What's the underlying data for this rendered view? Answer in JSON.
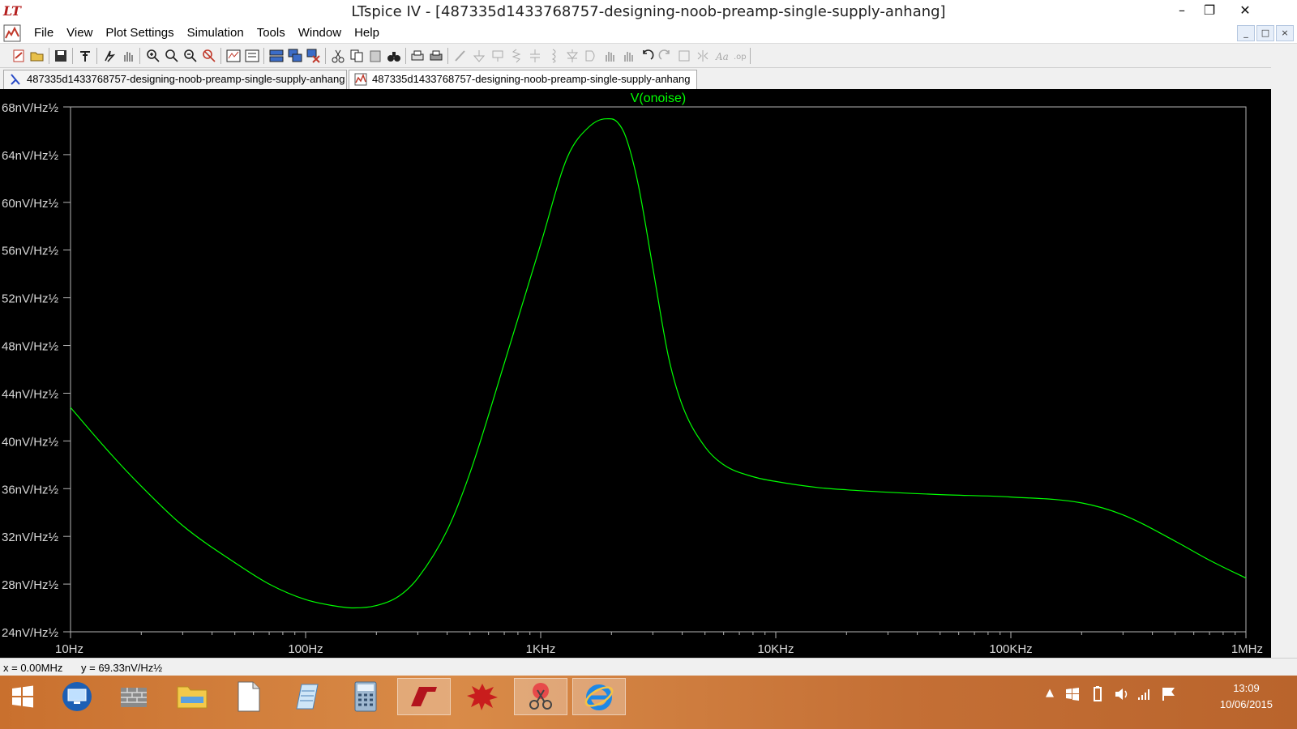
{
  "window": {
    "title": "LTspice IV - [487335d1433768757-designing-noob-preamp-single-supply-anhang]",
    "minimize": "–",
    "restore": "❐",
    "close": "✕"
  },
  "menu": {
    "items": [
      "File",
      "View",
      "Plot Settings",
      "Simulation",
      "Tools",
      "Window",
      "Help"
    ],
    "mdi": [
      "_",
      "□",
      "×"
    ]
  },
  "tabs": [
    {
      "label": "487335d1433768757-designing-noob-preamp-single-supply-anhang",
      "icon": "schematic-icon"
    },
    {
      "label": "487335d1433768757-designing-noob-preamp-single-supply-anhang",
      "icon": "waveform-icon"
    }
  ],
  "chart_data": {
    "type": "line",
    "title": "V(onoise)",
    "x_scale": "log",
    "xlim": [
      10,
      1000000
    ],
    "ylim": [
      24,
      68
    ],
    "x_ticks": [
      {
        "value": 10,
        "label": "10Hz"
      },
      {
        "value": 100,
        "label": "100Hz"
      },
      {
        "value": 1000,
        "label": "1KHz"
      },
      {
        "value": 10000,
        "label": "10KHz"
      },
      {
        "value": 100000,
        "label": "100KHz"
      },
      {
        "value": 1000000,
        "label": "1MHz"
      }
    ],
    "y_ticks": [
      {
        "value": 68,
        "label": "68nV/Hz½"
      },
      {
        "value": 64,
        "label": "64nV/Hz½"
      },
      {
        "value": 60,
        "label": "60nV/Hz½"
      },
      {
        "value": 56,
        "label": "56nV/Hz½"
      },
      {
        "value": 52,
        "label": "52nV/Hz½"
      },
      {
        "value": 48,
        "label": "48nV/Hz½"
      },
      {
        "value": 44,
        "label": "44nV/Hz½"
      },
      {
        "value": 40,
        "label": "40nV/Hz½"
      },
      {
        "value": 36,
        "label": "36nV/Hz½"
      },
      {
        "value": 32,
        "label": "32nV/Hz½"
      },
      {
        "value": 28,
        "label": "28nV/Hz½"
      },
      {
        "value": 24,
        "label": "24nV/Hz½"
      }
    ],
    "series": [
      {
        "name": "V(onoise)",
        "color": "#00ff00",
        "x": [
          10,
          15,
          20,
          30,
          50,
          70,
          100,
          130,
          160,
          200,
          250,
          300,
          400,
          500,
          700,
          1000,
          1300,
          1600,
          1900,
          2100,
          2300,
          2600,
          3000,
          3500,
          4000,
          5000,
          6000,
          8000,
          10000,
          15000,
          20000,
          30000,
          50000,
          100000,
          200000,
          300000,
          500000,
          700000,
          1000000
        ],
        "y": [
          42.8,
          38.8,
          36.2,
          32.9,
          29.8,
          28.0,
          26.7,
          26.2,
          26.0,
          26.2,
          27.0,
          28.5,
          32.5,
          37.3,
          46.5,
          56.5,
          63.8,
          66.3,
          67.0,
          66.8,
          65.5,
          61.5,
          54.5,
          47.0,
          43.0,
          39.5,
          38.0,
          37.0,
          36.6,
          36.1,
          35.9,
          35.7,
          35.5,
          35.3,
          34.8,
          33.8,
          31.6,
          30.0,
          28.5
        ]
      }
    ],
    "grid": false
  },
  "status": {
    "x_readout": "x = 0.00MHz",
    "y_readout": "y = 69.33nV/Hz½"
  },
  "taskbar": {
    "apps": [
      "start-icon",
      "remote-desktop-icon",
      "firewall-icon",
      "file-explorer-icon",
      "document-icon",
      "notepad-icon",
      "calculator-icon",
      "ltspice-icon",
      "paint-splash-icon",
      "snipping-tool-icon",
      "internet-explorer-icon"
    ],
    "time": "13:09",
    "date": "10/06/2015"
  },
  "colors": {
    "plot_bg": "#000000",
    "trace": "#00ff00",
    "axis": "#b4b4b4",
    "axis_label": "#d8d8d8"
  }
}
